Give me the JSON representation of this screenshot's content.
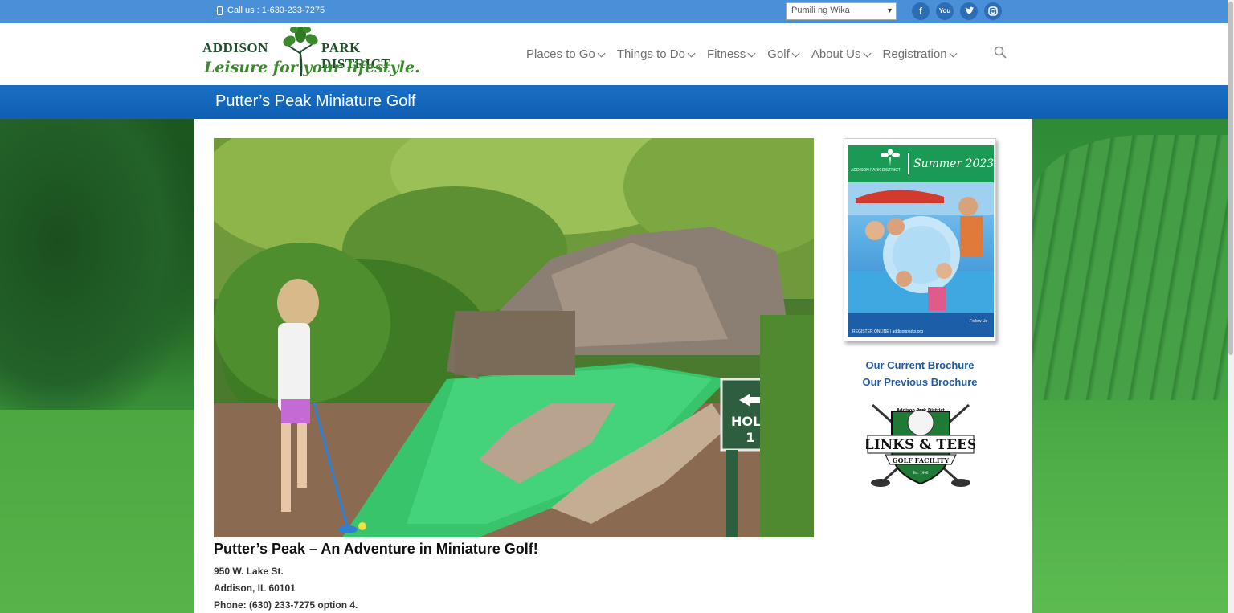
{
  "topbar": {
    "call_label": "Call us : 1-630-233-7275",
    "language_select": "Pumili ng Wika",
    "social": [
      "facebook-icon",
      "youtube-icon",
      "twitter-icon",
      "instagram-icon"
    ]
  },
  "header": {
    "logo": {
      "word1": "ADDISON",
      "word2": "PARK DISTRICT",
      "tagline": "Leisure for your lifestyle."
    },
    "nav": [
      {
        "label": "Places to Go"
      },
      {
        "label": "Things to Do"
      },
      {
        "label": "Fitness"
      },
      {
        "label": "Golf"
      },
      {
        "label": "About Us"
      },
      {
        "label": "Registration"
      }
    ]
  },
  "page": {
    "title": "Putter’s Peak Miniature Golf"
  },
  "article": {
    "heading": "Putter’s Peak – An Adventure in Miniature Golf!",
    "address1": "950 W. Lake St.",
    "address2": "Addison, IL 60101",
    "phone": "Phone: (630) 233-7275 option 4.",
    "hero_sign": "HOLE",
    "hero_sign_number": "1"
  },
  "sidebar": {
    "brochure": {
      "season": "Summer 2023",
      "org": "ADDISON PARK DISTRICT",
      "register": "REGISTER ONLINE | addisonparks.org",
      "follow": "Follow Us"
    },
    "links": [
      {
        "label": "Our Current Brochure"
      },
      {
        "label": "Our Previous Brochure"
      }
    ],
    "golf_logo": {
      "top": "Addison Park District",
      "main": "LINKS & TEES",
      "sub": "GOLF FACILITY",
      "est": "Est. 1990"
    }
  },
  "colors": {
    "topbar": "#4a90d9",
    "titleband": "#0f5fb3",
    "link": "#1f5ca8",
    "logo_green": "#3a8a2c"
  }
}
